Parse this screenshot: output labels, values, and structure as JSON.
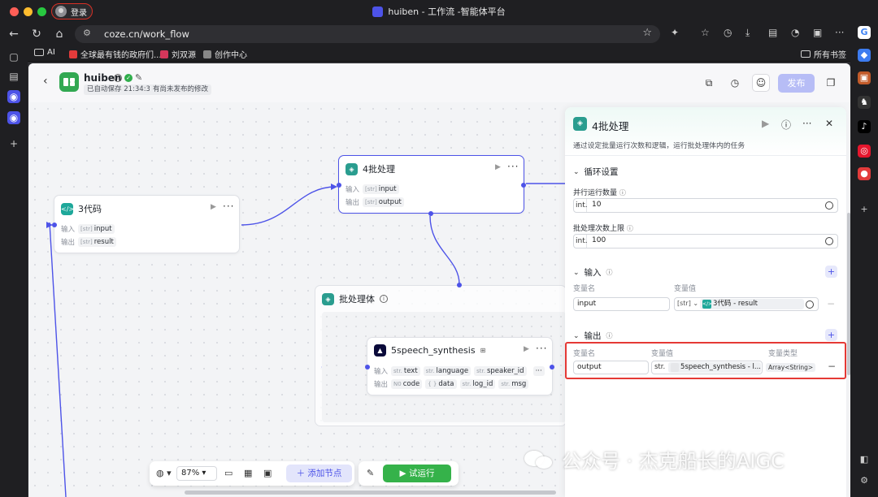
{
  "window": {
    "title": "huiben - 工作流 -智能体平台",
    "login_label": "登录"
  },
  "browser": {
    "url": "coze.cn/work_flow"
  },
  "bookmarks": [
    {
      "label": "AI"
    },
    {
      "label": "全球最有钱的政府们..."
    },
    {
      "label": "刘双源"
    },
    {
      "label": "创作中心"
    }
  ],
  "bookmarks_right": "所有书签",
  "app": {
    "name": "huiben",
    "autosave": "已自动保存 21:34:32",
    "unpublished": "有尚未发布的修改",
    "publish_label": "发布"
  },
  "nodes": {
    "code": {
      "title": "3代码",
      "in_label": "输入",
      "in_chip": "input",
      "out_label": "输出",
      "out_chip": "result",
      "in_type": "[str]",
      "out_type": "[str]"
    },
    "batch": {
      "title": "4批处理",
      "in_label": "输入",
      "in_chip": "input",
      "out_label": "输出",
      "out_chip": "output",
      "in_type": "[str]",
      "out_type": "[str]"
    },
    "batch_body": {
      "title": "批处理体"
    },
    "speech": {
      "title": "5speech_synthesis",
      "in_label": "输入",
      "in_chips": [
        {
          "type": "str.",
          "name": "text"
        },
        {
          "type": "str.",
          "name": "language"
        },
        {
          "type": "str.",
          "name": "speaker_id"
        }
      ],
      "out_label": "输出",
      "out_chips": [
        {
          "type": "N0",
          "name": "code"
        },
        {
          "type": "{ }",
          "name": "data"
        },
        {
          "type": "str.",
          "name": "log_id"
        },
        {
          "type": "str.",
          "name": "msg"
        }
      ]
    }
  },
  "toolbar": {
    "zoom": "87%",
    "add_node": "添加节点",
    "run": "试运行"
  },
  "panel": {
    "title": "4批处理",
    "description": "通过设定批量运行次数和逻辑，运行批处理体内的任务",
    "loop_section": "循环设置",
    "parallel_label": "并行运行数量",
    "parallel_type": "int.",
    "parallel_value": "10",
    "max_label": "批处理次数上限",
    "max_type": "int.",
    "max_value": "100",
    "input_section": "输入",
    "input_col_name": "变量名",
    "input_col_value": "变量值",
    "input_row": {
      "name": "input",
      "type": "[str]",
      "ref": "3代码 - result"
    },
    "output_section": "输出",
    "output_col_name": "变量名",
    "output_col_value": "变量值",
    "output_col_type": "变量类型",
    "output_row": {
      "name": "output",
      "type_prefix": "str.",
      "ref": "5speech_synthesis - l...",
      "var_type": "Array<String>"
    }
  },
  "watermark": "公众号 · 杰克船长的AIGC",
  "colors": {
    "accent": "#4d53e8",
    "run_green": "#35b24a",
    "highlight_red": "#e53935"
  }
}
